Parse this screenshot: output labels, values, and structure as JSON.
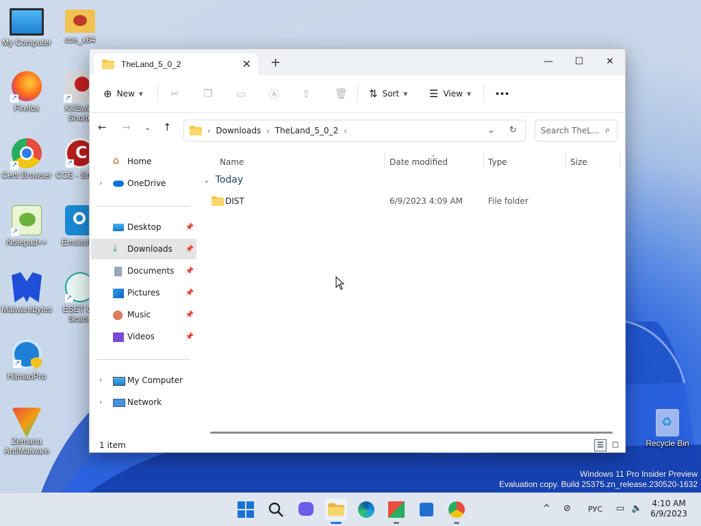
{
  "desktop": {
    "icons": [
      {
        "label": "My Computer"
      },
      {
        "label": "cce_x64"
      },
      {
        "label": "Firefox"
      },
      {
        "label": "KillSwitc Shortc"
      },
      {
        "label": "Cent Browser"
      },
      {
        "label": "CCE - Shortc"
      },
      {
        "label": "Notepad++"
      },
      {
        "label": "EmsisoftE"
      },
      {
        "label": "Malwarebytes"
      },
      {
        "label": "ESET On Scann"
      },
      {
        "label": "HitmanPro"
      },
      {
        "label": "Zemana AntiMalware"
      },
      {
        "label": "Recycle Bin"
      }
    ]
  },
  "watermark": {
    "line1": "Windows 11 Pro Insider Preview",
    "line2": "Evaluation copy. Build 25375.zn_release.230520-1632"
  },
  "explorer": {
    "tab_title": "TheLand_5_0_2",
    "new_tab": "+",
    "controls": {
      "minimize": "—",
      "maximize": "☐",
      "close": "✕"
    },
    "toolbar": {
      "new_label": "New",
      "sort_label": "Sort",
      "view_label": "View",
      "more": "•••"
    },
    "breadcrumb": [
      "Downloads",
      "TheLand_5_0_2"
    ],
    "search_placeholder": "Search TheL...",
    "sidebar": {
      "home": "Home",
      "onedrive": "OneDrive",
      "quick": [
        "Desktop",
        "Downloads",
        "Documents",
        "Pictures",
        "Music",
        "Videos"
      ],
      "my_computer": "My Computer",
      "network": "Network"
    },
    "columns": {
      "name": "Name",
      "date": "Date modified",
      "type": "Type",
      "size": "Size"
    },
    "group": "Today",
    "files": [
      {
        "name": "DIST",
        "date": "6/9/2023 4:09 AM",
        "type": "File folder",
        "size": ""
      }
    ],
    "status": "1 item"
  },
  "taskbar": {
    "language": "РУС",
    "time": "4:10 AM",
    "date": "6/9/2023"
  },
  "colors": {
    "accent": "#0067c0",
    "folder": "#f2c94c",
    "selected": "#e5e5e5"
  }
}
